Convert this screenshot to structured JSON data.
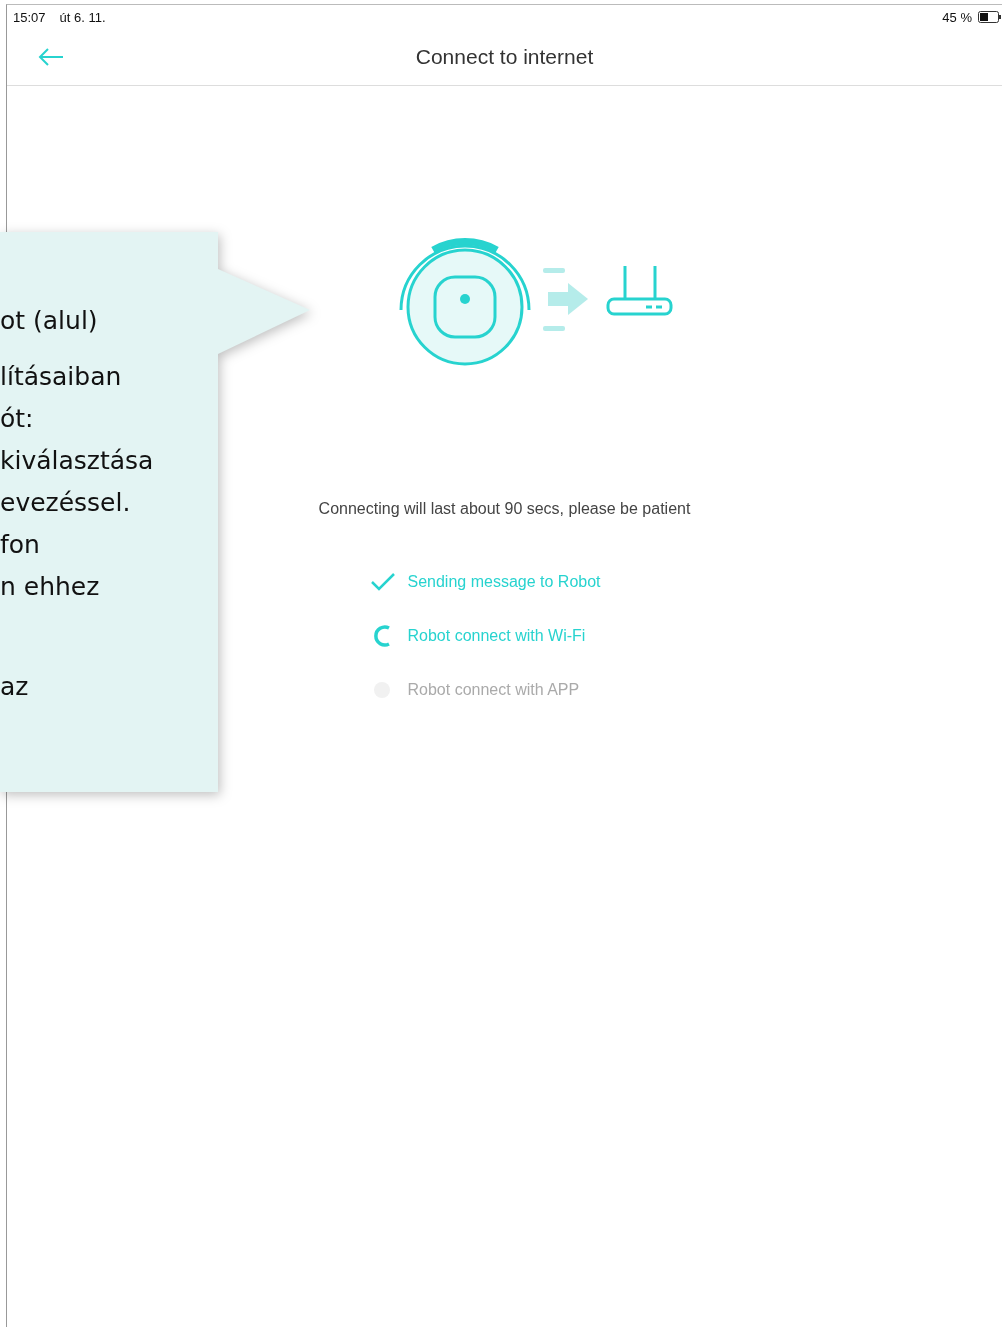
{
  "status_bar": {
    "time": "15:07",
    "date": "út 6. 11.",
    "battery": "45 %"
  },
  "nav": {
    "title": "Connect to internet"
  },
  "message": "Connecting will last about 90 secs, please be patient",
  "steps": [
    {
      "label": "Sending message to Robot",
      "kind": "done"
    },
    {
      "label": "Robot connect with Wi-Fi",
      "kind": "active"
    },
    {
      "label": "Robot connect with APP",
      "kind": "pending"
    }
  ],
  "callout": {
    "paragraphs": [
      [
        "ot (alul)"
      ],
      [
        "lításaiban",
        "ót:",
        "kiválasztása",
        "evezéssel.",
        "fon",
        "n ehhez"
      ],
      [
        "az"
      ]
    ]
  }
}
